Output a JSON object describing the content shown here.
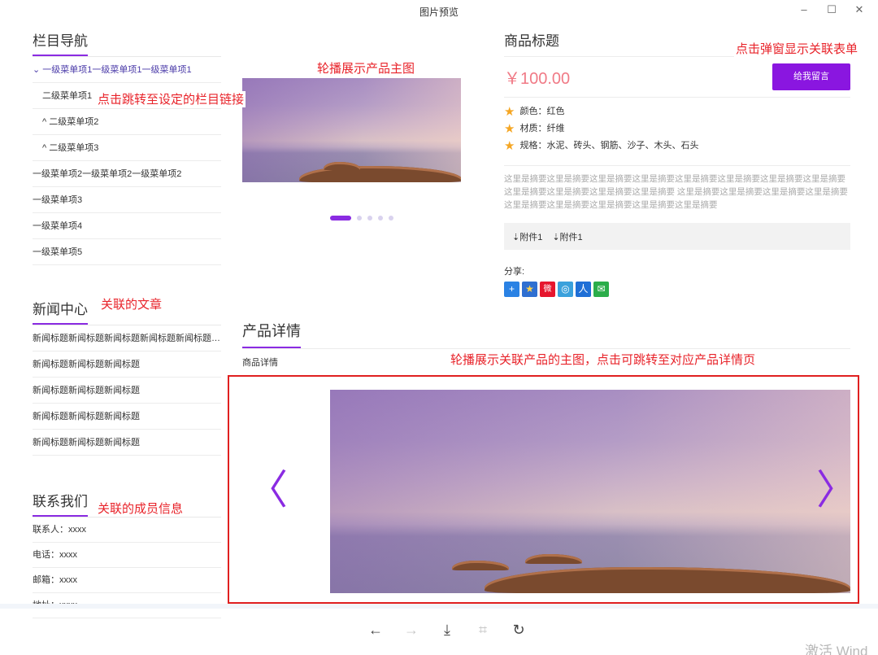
{
  "window": {
    "title": "图片预览",
    "controls": {
      "minimize": "–",
      "maximize": "☐",
      "close": "✕"
    }
  },
  "nav": {
    "title": "栏目导航",
    "items": [
      {
        "label": "⌄ 一级菜单项1一级菜单项1一级菜单项1"
      },
      {
        "label": "二级菜单项1"
      },
      {
        "label": "^ 二级菜单项2"
      },
      {
        "label": "^ 二级菜单项3"
      },
      {
        "label": "一级菜单项2一级菜单项2一级菜单项2"
      },
      {
        "label": "一级菜单项3"
      },
      {
        "label": "一级菜单项4"
      },
      {
        "label": "一级菜单项5"
      }
    ]
  },
  "news": {
    "title": "新闻中心",
    "items": [
      "新闻标题新闻标题新闻标题新闻标题新闻标题新闻标题",
      "新闻标题新闻标题新闻标题",
      "新闻标题新闻标题新闻标题",
      "新闻标题新闻标题新闻标题",
      "新闻标题新闻标题新闻标题"
    ]
  },
  "contact": {
    "title": "联系我们",
    "rows": [
      "联系人：xxxx",
      "电话：xxxx",
      "邮箱：xxxx",
      "地址：xxxx"
    ]
  },
  "product": {
    "title": "商品标题",
    "price": "￥100.00",
    "message_button": "给我留言",
    "attributes": [
      "颜色：红色",
      "材质：纤维",
      "规格：水泥、砖头、钢筋、沙子、木头、石头"
    ],
    "summary": "这里是摘要这里是摘要这里是摘要这里是摘要这里是摘要这里是摘要这里是摘要这里是摘要这里是摘要这里是摘要这里是摘要这里是摘要 这里是摘要这里是摘要这里是摘要这里是摘要这里是摘要这里是摘要这里是摘要这里是摘要这里是摘要",
    "attachments": [
      "⇣附件1",
      "⇣附件1"
    ],
    "share_label": "分享:",
    "share_icons": [
      {
        "name": "plus",
        "glyph": "+",
        "color": "#2a82e4"
      },
      {
        "name": "qzone",
        "glyph": "★",
        "color": "#2f6fd1"
      },
      {
        "name": "weibo",
        "glyph": "微",
        "color": "#e6162d"
      },
      {
        "name": "tencent-weibo",
        "glyph": "◎",
        "color": "#3aa1dc"
      },
      {
        "name": "renren",
        "glyph": "人",
        "color": "#1f6fd6"
      },
      {
        "name": "wechat",
        "glyph": "✉",
        "color": "#2bad4a"
      }
    ]
  },
  "carousel": {
    "slide_count": 5,
    "active_index": 0
  },
  "detail": {
    "title": "产品详情",
    "subtitle": "商品详情"
  },
  "annotations": {
    "main_image": "轮播展示产品主图",
    "nav_link": "点击跳转至设定的栏目链接",
    "popup_form": "点击弹窗显示关联表单",
    "related_article": "关联的文章",
    "related_products": "轮播展示关联产品的主图，点击可跳转至对应产品详情页",
    "member_info": "关联的成员信息"
  },
  "related_carousel": {
    "prev": "〈",
    "next": "〉"
  },
  "toolbar": {
    "back": "←",
    "forward": "→",
    "download": "⤓",
    "fit": "⌗",
    "rotate": "↻"
  },
  "watermark": "激活 Wind",
  "colors": {
    "accent": "#8a16e0",
    "price": "#f07a86",
    "annotation": "#e8232a"
  }
}
